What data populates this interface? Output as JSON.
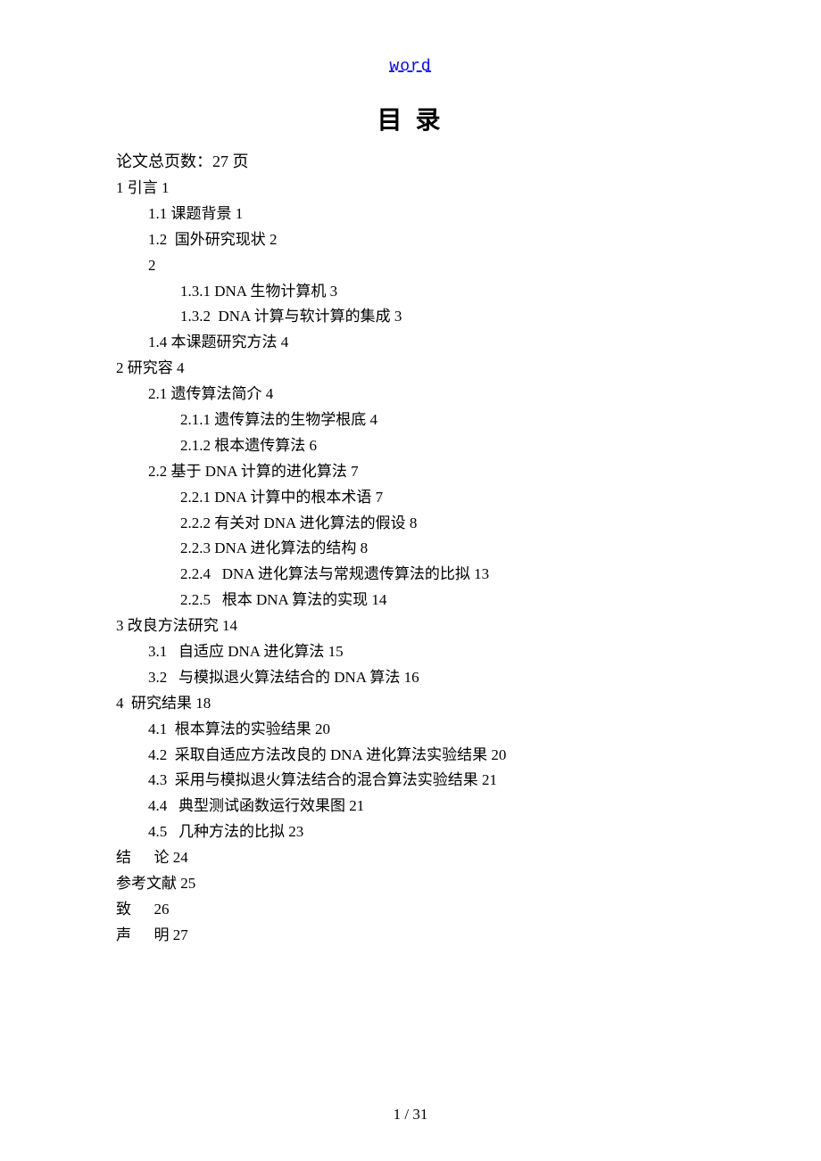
{
  "header": {
    "word_link": "word"
  },
  "title": "目 录",
  "total_pages": "论文总页数：27 页",
  "toc": [
    {
      "indent": 0,
      "text": "1 引言 1"
    },
    {
      "indent": 1,
      "text": "1.1 课题背景 1"
    },
    {
      "indent": 1,
      "text": "1.2  国外研究现状 2"
    },
    {
      "indent": 1,
      "text": "2"
    },
    {
      "indent": 2,
      "text": "1.3.1 DNA 生物计算机 3"
    },
    {
      "indent": 2,
      "text": "1.3.2  DNA 计算与软计算的集成 3"
    },
    {
      "indent": 1,
      "text": "1.4 本课题研究方法 4"
    },
    {
      "indent": 0,
      "text": "2 研究容 4"
    },
    {
      "indent": 1,
      "text": "2.1 遗传算法简介 4"
    },
    {
      "indent": 2,
      "text": "2.1.1 遗传算法的生物学根底 4"
    },
    {
      "indent": 2,
      "text": "2.1.2 根本遗传算法 6"
    },
    {
      "indent": 1,
      "text": "2.2 基于 DNA 计算的进化算法 7"
    },
    {
      "indent": 2,
      "text": "2.2.1 DNA 计算中的根本术语 7"
    },
    {
      "indent": 2,
      "text": "2.2.2 有关对 DNA 进化算法的假设 8"
    },
    {
      "indent": 2,
      "text": "2.2.3 DNA 进化算法的结构 8"
    },
    {
      "indent": 2,
      "text": "2.2.4   DNA 进化算法与常规遗传算法的比拟 13"
    },
    {
      "indent": 2,
      "text": "2.2.5   根本 DNA 算法的实现 14"
    },
    {
      "indent": 0,
      "text": "3 改良方法研究 14"
    },
    {
      "indent": 1,
      "text": "3.1   自适应 DNA 进化算法 15"
    },
    {
      "indent": 1,
      "text": "3.2   与模拟退火算法结合的 DNA 算法 16"
    },
    {
      "indent": 0,
      "text": "4  研究结果 18"
    },
    {
      "indent": 1,
      "text": "4.1  根本算法的实验结果 20"
    },
    {
      "indent": 1,
      "text": "4.2  采取自适应方法改良的 DNA 进化算法实验结果 20"
    },
    {
      "indent": 1,
      "text": "4.3  采用与模拟退火算法结合的混合算法实验结果 21"
    },
    {
      "indent": 1,
      "text": "4.4   典型测试函数运行效果图 21"
    },
    {
      "indent": 1,
      "text": "4.5   几种方法的比拟 23"
    },
    {
      "indent": 0,
      "text": "结      论 24"
    },
    {
      "indent": 0,
      "text": "参考文献 25"
    },
    {
      "indent": 0,
      "text": "致      26"
    },
    {
      "indent": 0,
      "text": "声      明 27"
    }
  ],
  "footer": {
    "page_number": "1 / 31"
  }
}
